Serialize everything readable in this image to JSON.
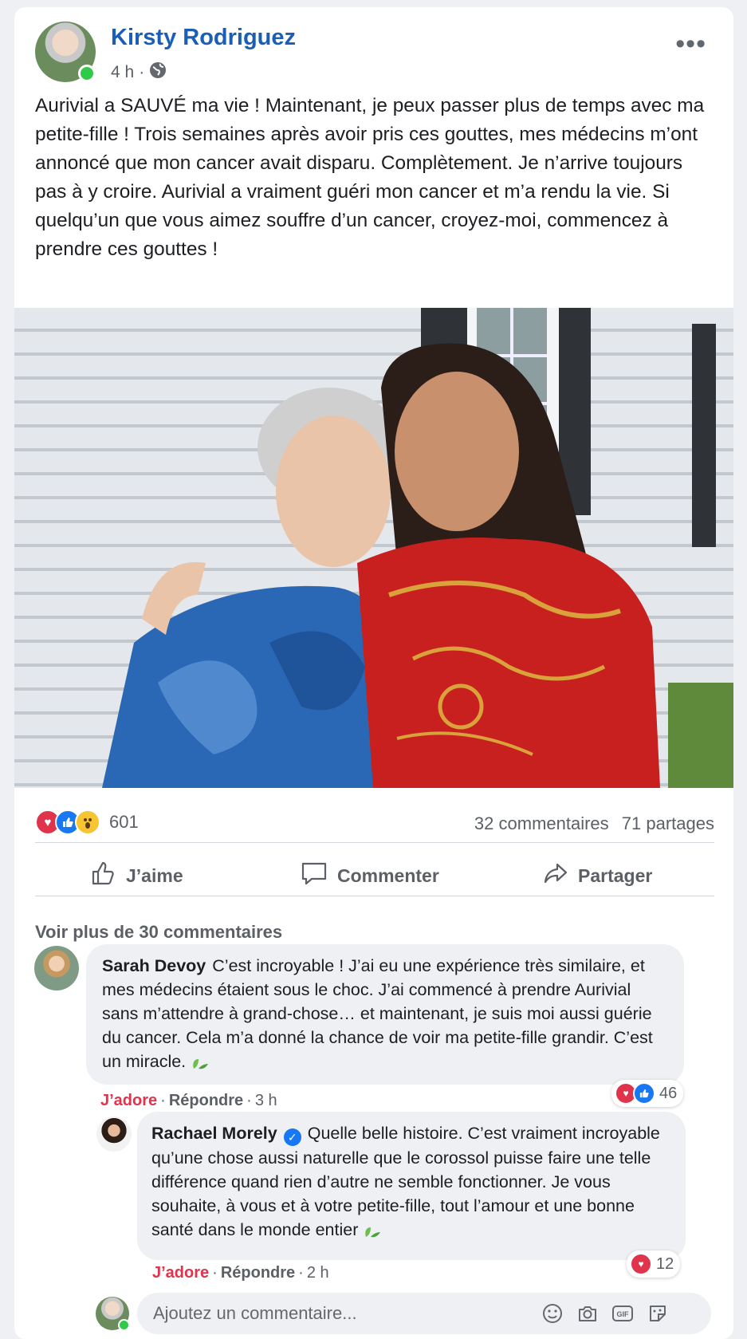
{
  "post": {
    "author": "Kirsty Rodriguez",
    "time": "4 h",
    "separator": "·",
    "more": "•••",
    "text": "Aurivial a SAUVÉ ma vie ! Maintenant, je peux passer plus de temps avec ma petite-fille ! Trois semaines après avoir pris ces gouttes, mes médecins m’ont annoncé que mon cancer avait disparu. Complètement. Je n’arrive toujours pas à y croire. Aurivial a vraiment guéri mon cancer et m’a rendu la vie. Si quelqu’un que vous aimez souffre d’un cancer, croyez-moi, commencez à prendre ces gouttes !"
  },
  "stats": {
    "reaction_count": "601",
    "comments": "32 commentaires",
    "shares": "71 partages"
  },
  "actions": {
    "like": "J’aime",
    "comment": "Commenter",
    "share": "Partager"
  },
  "comments_section": {
    "see_more": "Voir plus de 30 commentaires",
    "comments": [
      {
        "author": "Sarah Devoy",
        "text": "C’est incroyable ! J’ai eu une expérience très similaire, et mes médecins étaient sous le choc. J’ai commencé à prendre Aurivial sans m’attendre à grand-chose… et maintenant, je suis moi aussi guérie du cancer. Cela m’a donné la chance de voir ma petite-fille grandir. C’est un miracle.",
        "love": "J’adore",
        "reply": "Répondre",
        "time": "3 h",
        "reactions": "46"
      },
      {
        "author": "Rachael Morely",
        "text": "Quelle belle histoire. C’est vraiment incroyable qu’une chose aussi naturelle que le corossol puisse faire une telle différence quand rien d’autre ne semble fonctionner. Je vous souhaite, à vous et à votre petite-fille, tout l’amour et une bonne santé dans le monde entier",
        "love": "J’adore",
        "reply": "Répondre",
        "time": "2 h",
        "reactions": "12"
      }
    ]
  },
  "composer": {
    "placeholder": "Ajoutez un commentaire..."
  },
  "colors": {
    "author_blue": "#1b5eb5",
    "love_red": "#e0334c",
    "like_blue": "#1877f2",
    "online_green": "#31c948"
  }
}
